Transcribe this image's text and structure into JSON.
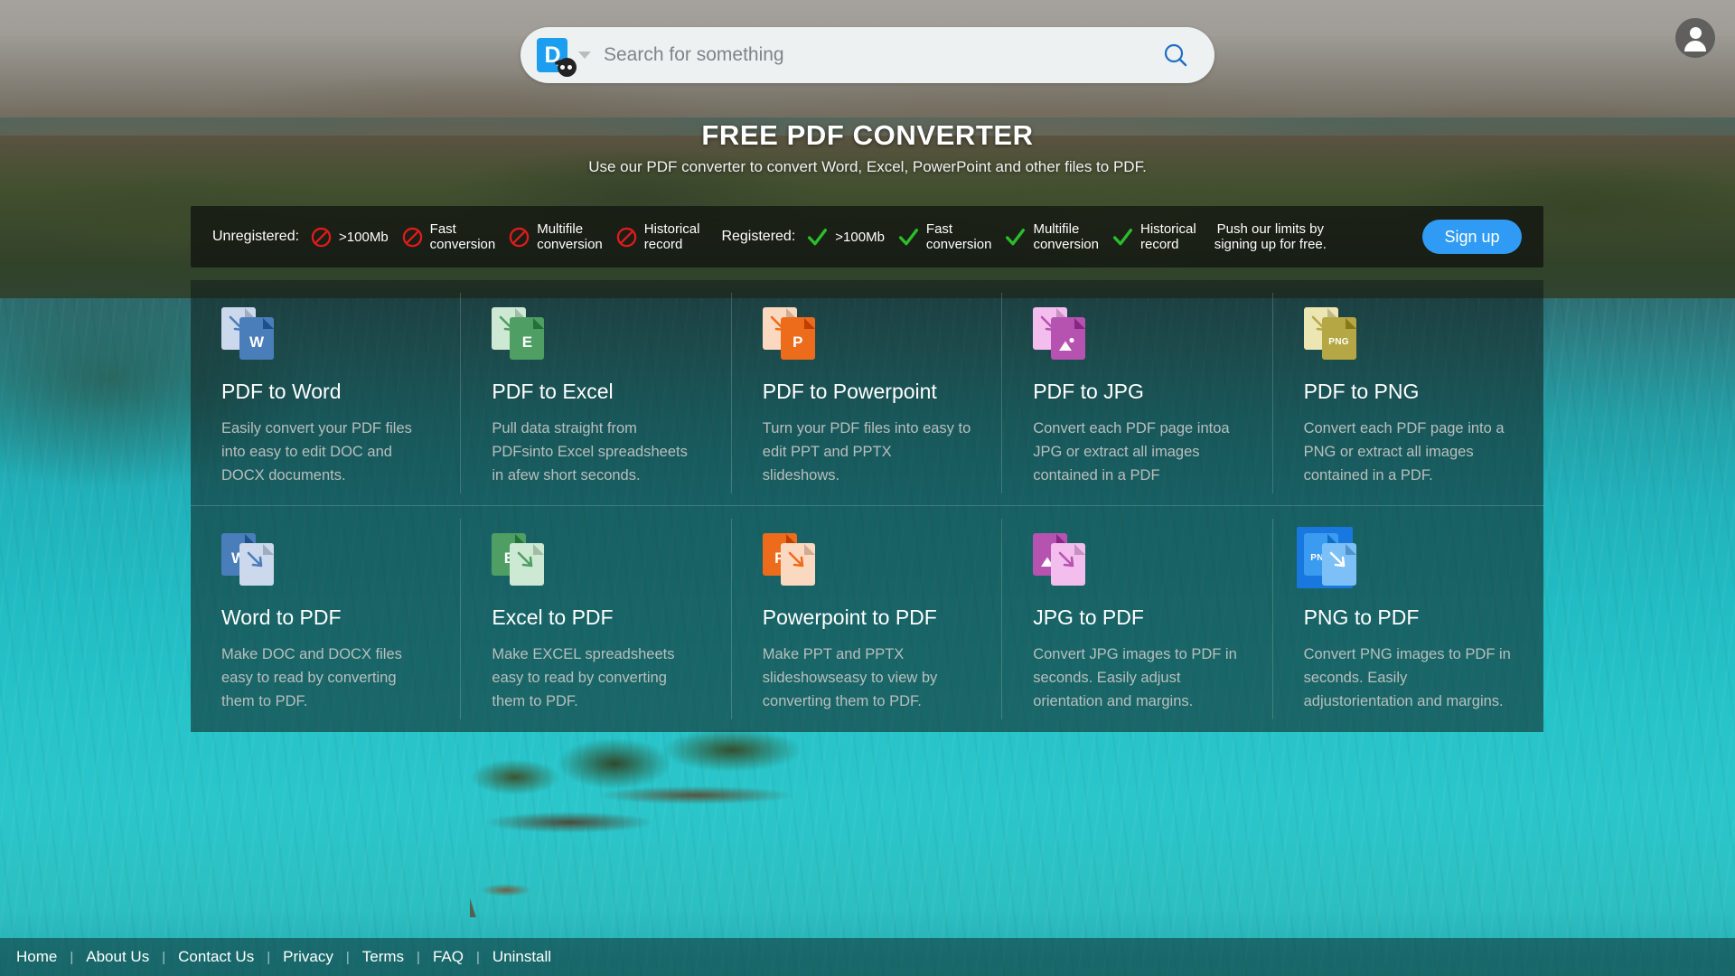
{
  "search": {
    "logo_letter": "D",
    "logo_icon": "ninja-icon",
    "placeholder": "Search for something",
    "value": "",
    "search_icon": "search-icon",
    "dropdown_icon": "chevron-down-icon"
  },
  "account": {
    "avatar_icon": "user-avatar-icon"
  },
  "hero": {
    "title": "FREE PDF CONVERTER",
    "subtitle": "Use our PDF converter to convert Word, Excel, PowerPoint and other files to PDF."
  },
  "feature_bar": {
    "unregistered_label": "Unregistered:",
    "registered_label": "Registered:",
    "deny_icon": "no-entry-icon",
    "allow_icon": "check-icon",
    "unregistered_items": [
      {
        "text": ">100Mb",
        "state": "denied"
      },
      {
        "text": "Fast\nconversion",
        "state": "denied"
      },
      {
        "text": "Multifile\nconversion",
        "state": "denied"
      },
      {
        "text": "Historical\nrecord",
        "state": "denied"
      }
    ],
    "registered_items": [
      {
        "text": ">100Mb",
        "state": "allowed"
      },
      {
        "text": "Fast\nconversion",
        "state": "allowed"
      },
      {
        "text": "Multifile\nconversion",
        "state": "allowed"
      },
      {
        "text": "Historical\nrecord",
        "state": "allowed"
      }
    ],
    "note": "Push our limits by\nsigning up for free.",
    "signup_label": "Sign up",
    "signup_color": "#2f9bf5"
  },
  "tools": [
    {
      "title": "PDF to Word",
      "desc": "Easily convert your PDF files into easy to edit DOC and DOCX documents.",
      "icon": "pdf-to-word-icon",
      "badge": "W",
      "badge_small": false,
      "color": "#4a7ebb",
      "light": "#ccd8ec",
      "direction": "from-pdf",
      "selected": false
    },
    {
      "title": "PDF to Excel",
      "desc": "Pull data straight from PDFsinto Excel spreadsheets in afew short seconds.",
      "icon": "pdf-to-excel-icon",
      "badge": "E",
      "badge_small": false,
      "color": "#4f9e63",
      "light": "#cde8d3",
      "direction": "from-pdf",
      "selected": false
    },
    {
      "title": "PDF to Powerpoint",
      "desc": "Turn your PDF files into easy to edit PPT and PPTX slideshows.",
      "icon": "pdf-to-powerpoint-icon",
      "badge": "P",
      "badge_small": false,
      "color": "#ed6c1c",
      "light": "#fbd9c0",
      "direction": "from-pdf",
      "selected": false
    },
    {
      "title": "PDF to JPG",
      "desc": "Convert each PDF page intoa JPG or extract all images contained in a PDF",
      "icon": "pdf-to-jpg-icon",
      "badge": "image",
      "badge_small": false,
      "color": "#b653b0",
      "light": "#f3bdee",
      "direction": "from-pdf",
      "selected": false
    },
    {
      "title": "PDF to PNG",
      "desc": "Convert each PDF page into a PNG or extract all images contained in a PDF.",
      "icon": "pdf-to-png-icon",
      "badge": "PNG",
      "badge_small": true,
      "color": "#b5a844",
      "light": "#ece5b4",
      "direction": "from-pdf",
      "selected": false
    },
    {
      "title": "Word to PDF",
      "desc": "Make DOC and DOCX files easy to read by converting them to PDF.",
      "icon": "word-to-pdf-icon",
      "badge": "W",
      "badge_small": false,
      "color": "#4a7ebb",
      "light": "#ccd8ec",
      "direction": "to-pdf",
      "selected": false
    },
    {
      "title": "Excel to PDF",
      "desc": "Make EXCEL spreadsheets easy to read by converting them to PDF.",
      "icon": "excel-to-pdf-icon",
      "badge": "E",
      "badge_small": false,
      "color": "#4f9e63",
      "light": "#cde8d3",
      "direction": "to-pdf",
      "selected": false
    },
    {
      "title": "Powerpoint to PDF",
      "desc": "Make PPT and PPTX slideshowseasy to view by converting them to PDF.",
      "icon": "powerpoint-to-pdf-icon",
      "badge": "P",
      "badge_small": false,
      "color": "#ed6c1c",
      "light": "#fbd9c0",
      "direction": "to-pdf",
      "selected": false
    },
    {
      "title": "JPG to PDF",
      "desc": "Convert JPG images to PDF in seconds. Easily adjust orientation and margins.",
      "icon": "jpg-to-pdf-icon",
      "badge": "image",
      "badge_small": false,
      "color": "#b653b0",
      "light": "#f3bdee",
      "direction": "to-pdf",
      "selected": false
    },
    {
      "title": "PNG to PDF",
      "desc": "Convert PNG images to PDF in seconds. Easily adjustorientation and margins.",
      "icon": "png-to-pdf-icon",
      "badge": "PNG",
      "badge_small": true,
      "color": "#3a9bf0",
      "light": "#7cc0f7",
      "direction": "to-pdf",
      "selected": true
    }
  ],
  "footer": {
    "links": [
      "Home",
      "About Us",
      "Contact Us",
      "Privacy",
      "Terms",
      "FAQ",
      "Uninstall"
    ]
  }
}
